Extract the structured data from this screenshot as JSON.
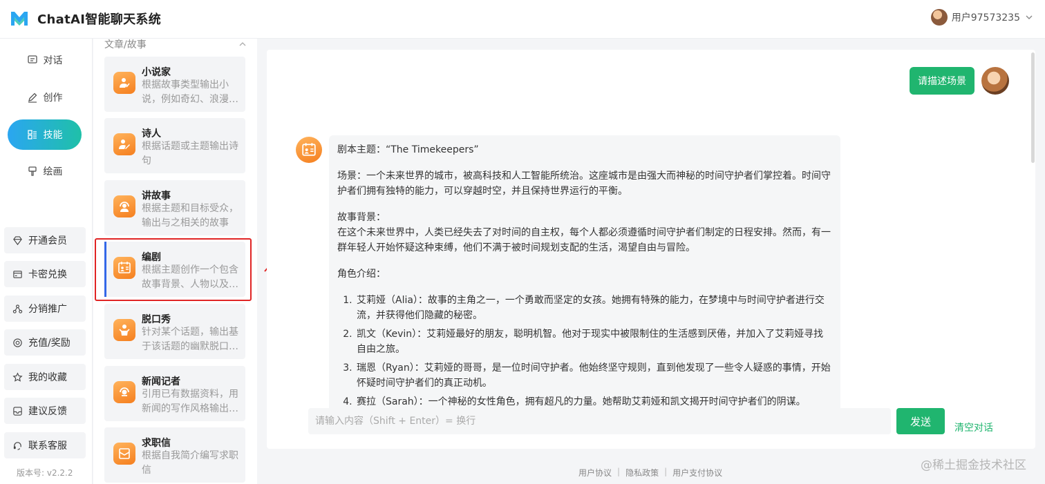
{
  "app": {
    "title": "ChatAI智能聊天系统"
  },
  "user": {
    "name": "用户97573235"
  },
  "nav": {
    "items": [
      {
        "label": "对话",
        "icon": "chat-icon"
      },
      {
        "label": "创作",
        "icon": "pen-icon"
      },
      {
        "label": "技能",
        "icon": "skills-icon",
        "active": true
      },
      {
        "label": "绘画",
        "icon": "brush-icon"
      }
    ],
    "buttons": [
      {
        "label": "开通会员",
        "icon": "diamond-icon"
      },
      {
        "label": "卡密兑换",
        "icon": "card-icon"
      },
      {
        "label": "分销推广",
        "icon": "share-icon"
      },
      {
        "label": "充值/奖励",
        "icon": "coin-icon"
      },
      {
        "label": "我的收藏",
        "icon": "star-icon"
      },
      {
        "label": "建议反馈",
        "icon": "feedback-icon"
      },
      {
        "label": "联系客服",
        "icon": "headset-icon"
      }
    ],
    "version": "版本号: v2.2.2"
  },
  "skills": {
    "category": "文章/故事",
    "cards": [
      {
        "title": "小说家",
        "desc": "根据故事类型输出小说，例如奇幻、浪漫、科幻等"
      },
      {
        "title": "诗人",
        "desc": "根据话题或主题输出诗句"
      },
      {
        "title": "讲故事",
        "desc": "根据主题和目标受众，输出与之相关的故事"
      },
      {
        "title": "编剧",
        "desc": "根据主题创作一个包含故事背景、人物以及对话的剧本",
        "selected": true
      },
      {
        "title": "脱口秀",
        "desc": "针对某个话题，输出基于该话题的幽默脱口秀内容"
      },
      {
        "title": "新闻记者",
        "desc": "引用已有数据资料，用新闻的写作风格输出主题文章"
      },
      {
        "title": "求职信",
        "desc": "根据自我简介编写求职信"
      }
    ]
  },
  "chat": {
    "user_message": "请描述场景",
    "bot": {
      "theme": "剧本主题：“The Timekeepers”",
      "scene": "场景：一个未来世界的城市，被高科技和人工智能所统治。这座城市是由强大而神秘的时间守护者们掌控着。时间守护者们拥有独特的能力，可以穿越时空，并且保持世界运行的平衡。",
      "background_title": "故事背景：",
      "background": "在这个未来世界中，人类已经失去了对时间的自主权，每个人都必须遵循时间守护者们制定的日程安排。然而，有一群年轻人开始怀疑这种束缚，他们不满于被时间规划支配的生活，渴望自由与冒险。",
      "roles_title": "角色介绍：",
      "roles": [
        "艾莉娅（Alia）：故事的主角之一，一个勇敢而坚定的女孩。她拥有特殊的能力，在梦境中与时间守护者进行交流，并获得他们隐藏的秘密。",
        "凯文（Kevin）：艾莉娅最好的朋友，聪明机智。他对于现实中被限制住的生活感到厌倦，并加入了艾莉娅寻找自由之旅。",
        "瑞恩（Ryan）：艾莉娅的哥哥，是一位时间守护者。他始终坚守规则，直到他发现了一些令人疑惑的事情，开始怀疑时间守护者们的真正动机。",
        "赛拉（Sarah）：一个神秘的女性角色，拥有超凡的力量。她帮助艾莉娅和凯文揭开时间守护者们的阴谋。"
      ]
    },
    "input_placeholder": "请输入内容（Shift + Enter）= 换行",
    "send_label": "发送",
    "clear_label": "清空对话"
  },
  "footer": {
    "links": [
      "用户协议",
      "隐私政策",
      "用户支付协议"
    ],
    "separator": "|"
  },
  "watermark": "@稀土掘金技术社区",
  "colors": {
    "accent": "#20b56f",
    "nav_gradient_start": "#2ba6f1",
    "nav_gradient_end": "#1fc0a8",
    "icon_orange": "#f57f1f",
    "highlight": "#e02424"
  }
}
